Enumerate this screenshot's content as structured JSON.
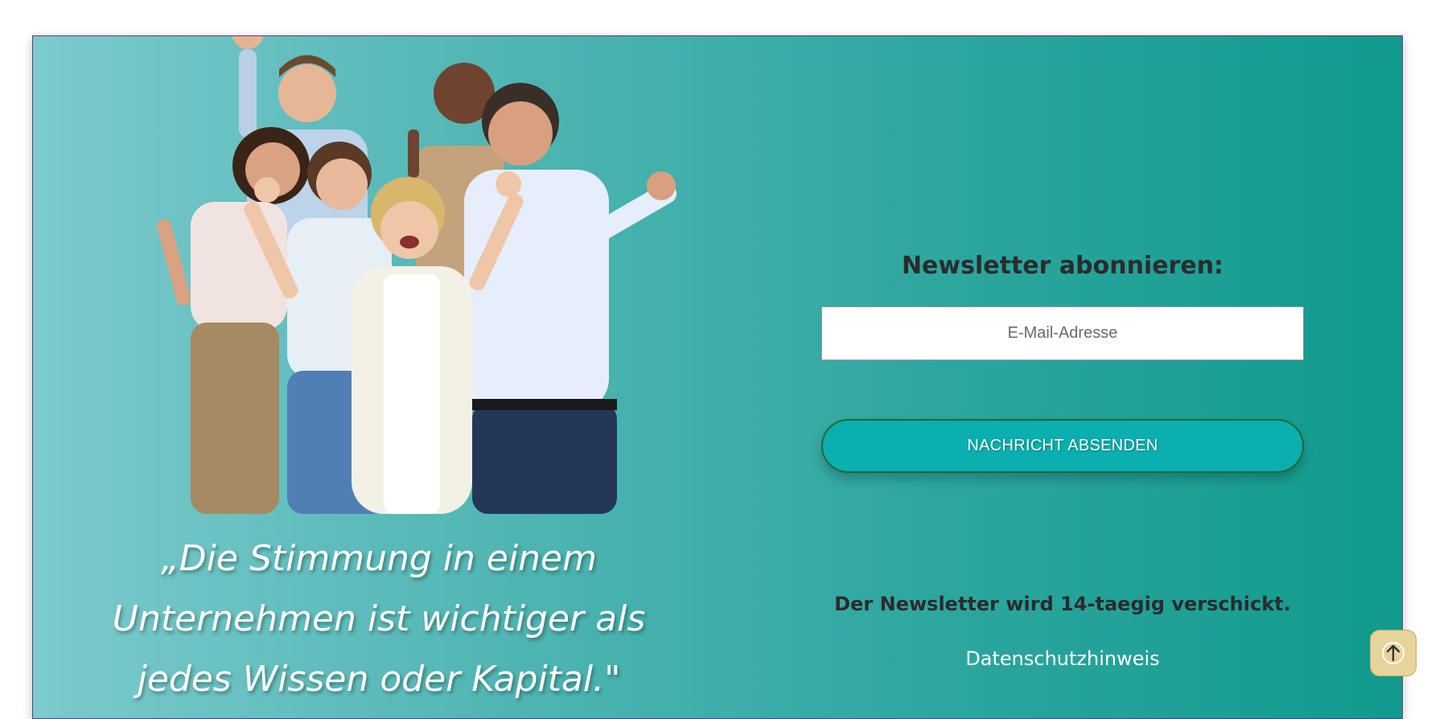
{
  "hero": {
    "image_alt": "cheering-business-team-photo",
    "quote": "„Die Stimmung in einem Unternehmen ist wichtiger als jedes Wissen oder Kapital.\""
  },
  "newsletter": {
    "title": "Newsletter abonnieren:",
    "email_placeholder": "E-Mail-Adresse",
    "submit_label": "NACHRICHT ABSENDEN",
    "note": "Der Newsletter wird 14-taegig verschickt.",
    "privacy_link": "Datenschutzhinweis"
  },
  "scroll_top": {
    "icon": "arrow-up-icon"
  },
  "colors": {
    "gradient_start": "#7ccacd",
    "gradient_end": "#119a8d",
    "button": "#0bafaf",
    "button_border": "#1c6b33",
    "scroll_button": "#e7d49a"
  }
}
